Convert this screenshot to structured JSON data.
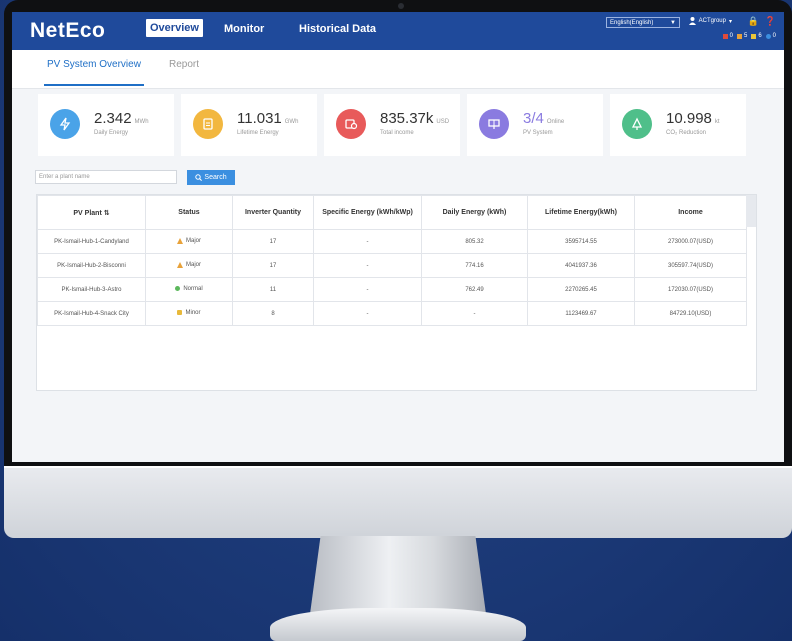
{
  "header": {
    "logo": "NetEco",
    "nav": [
      "Overview",
      "Monitor",
      "Historical Data"
    ],
    "language": "English(English)",
    "user": "ACTgroup",
    "alarms": [
      {
        "count": "0",
        "color": "#e04b3b"
      },
      {
        "count": "5",
        "color": "#e8a23a"
      },
      {
        "count": "6",
        "color": "#e8c63a"
      },
      {
        "count": "0",
        "color": "#3b8fe0"
      }
    ]
  },
  "tabs": [
    "PV System Overview",
    "Report"
  ],
  "cards": [
    {
      "value": "2.342",
      "unit": "MWh",
      "label": "Daily Energy",
      "icon": "bolt-icon",
      "color": "#4aa3e8"
    },
    {
      "value": "11.031",
      "unit": "GWh",
      "label": "Lifetime Energy",
      "icon": "battery-icon",
      "color": "#f2b73f"
    },
    {
      "value": "835.37k",
      "unit": "USD",
      "label": "Total income",
      "icon": "income-icon",
      "color": "#e85a5a"
    },
    {
      "value": "3/4",
      "unit": "Online",
      "label": "PV System",
      "icon": "solar-panel-icon",
      "color": "#8a7be0"
    },
    {
      "value": "10.998",
      "unit": "kt",
      "label": "CO₂ Reduction",
      "icon": "tree-icon",
      "color": "#4fbf8a"
    }
  ],
  "search": {
    "placeholder": "Enter a plant name",
    "button": "Search"
  },
  "table": {
    "headers": [
      "PV Plant",
      "Status",
      "Inverter Quantity",
      "Specific Energy (kWh/kWp)",
      "Daily Energy (kWh)",
      "Lifetime Energy(kWh)",
      "Income"
    ],
    "rows": [
      [
        "PK-Ismail-Hub-1-Candyland",
        "Major",
        "17",
        "-",
        "805.32",
        "3595714.55",
        "273000.07(USD)"
      ],
      [
        "PK-Ismail-Hub-2-Bisconni",
        "Major",
        "17",
        "-",
        "774.16",
        "4041937.36",
        "305597.74(USD)"
      ],
      [
        "PK-Ismail-Hub-3-Astro",
        "Normal",
        "11",
        "-",
        "762.49",
        "2270265.45",
        "172030.07(USD)"
      ],
      [
        "PK-Ismail-Hub-4-Snack City",
        "Minor",
        "8",
        "-",
        "-",
        "1123469.67",
        "84729.10(USD)"
      ]
    ]
  }
}
